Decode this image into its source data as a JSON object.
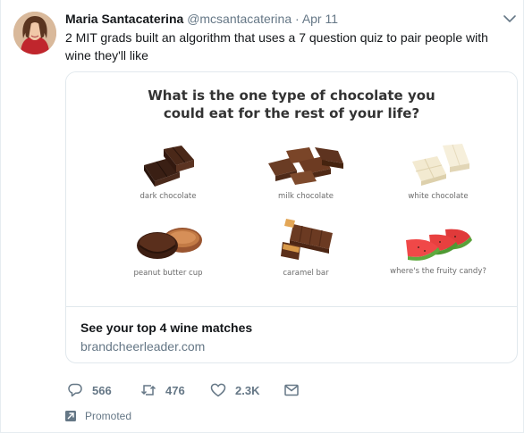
{
  "tweet": {
    "author_name": "Maria Santacaterina",
    "author_handle": "@mcsantacaterina",
    "separator": "·",
    "timestamp": "Apr 11",
    "text": "2 MIT grads built an algorithm that uses a 7 question quiz to pair people with wine they'll like"
  },
  "card": {
    "question": "What is the one type of chocolate you could eat for the rest of your life?",
    "options": [
      {
        "label": "dark chocolate",
        "icon": "dark-chocolate-icon"
      },
      {
        "label": "milk chocolate",
        "icon": "milk-chocolate-icon"
      },
      {
        "label": "white chocolate",
        "icon": "white-chocolate-icon"
      },
      {
        "label": "peanut butter cup",
        "icon": "peanut-butter-cup-icon"
      },
      {
        "label": "caramel bar",
        "icon": "caramel-bar-icon"
      },
      {
        "label": "where's the fruity candy?",
        "icon": "fruity-candy-icon"
      }
    ],
    "title": "See your top 4 wine matches",
    "domain": "brandcheerleader.com"
  },
  "actions": {
    "replies": "566",
    "retweets": "476",
    "likes": "2.3K"
  },
  "promoted_label": "Promoted",
  "colors": {
    "text_primary": "#14171a",
    "text_secondary": "#657786",
    "border": "#e1e8ed"
  }
}
